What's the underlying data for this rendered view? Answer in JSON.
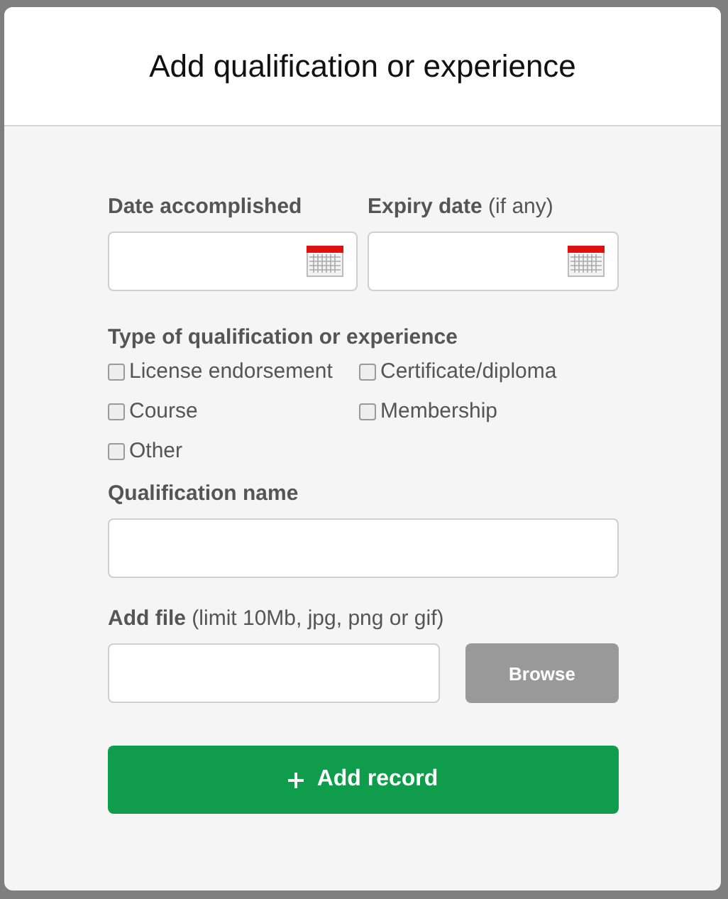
{
  "dialog": {
    "title": "Add qualification or experience"
  },
  "date_fields": [
    {
      "label": "Date accomplished"
    },
    {
      "label": "Expiry date",
      "note": "(if any)"
    }
  ],
  "type_group": {
    "label": "Type of qualification or experience",
    "options": [
      {
        "label": "License endorsement",
        "checked": false
      },
      {
        "label": "Certificate/diploma",
        "checked": false
      },
      {
        "label": "Course",
        "checked": false
      },
      {
        "label": "Membership",
        "checked": false
      },
      {
        "label": "Other",
        "checked": false
      }
    ]
  },
  "name_field": {
    "label": "Qualification name"
  },
  "file_field": {
    "label": "Add file",
    "note": "(limit 10Mb, jpg, png or gif)",
    "button": "Browse"
  },
  "submit": {
    "label": "Add record"
  }
}
